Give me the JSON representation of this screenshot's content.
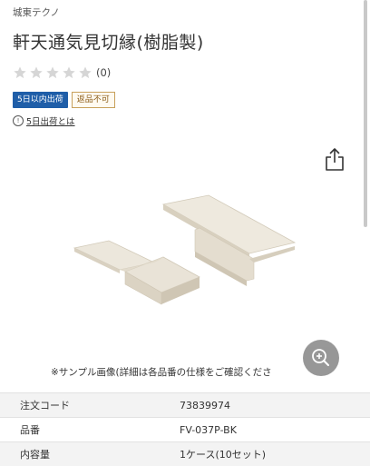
{
  "header": {
    "brand": "城東テクノ",
    "title": "軒天通気見切縁(樹脂製)"
  },
  "rating": {
    "stars_filled": 0,
    "stars_total": 5,
    "count_text": "(0)",
    "star_color": "#d6d6d6"
  },
  "badges": {
    "shipping": "5日以内出荷",
    "no_return": "返品不可"
  },
  "shipping_info": {
    "icon": "info-icon",
    "icon_glyph": "!",
    "link_text": "5日出荷とは"
  },
  "actions": {
    "share_icon": "share-icon",
    "zoom_icon": "zoom-in-icon"
  },
  "image": {
    "caption": "※サンプル画像(詳細は各品番の仕様をご確認くださ"
  },
  "specs": [
    {
      "label": "注文コード",
      "value": "73839974"
    },
    {
      "label": "品番",
      "value": "FV-037P-BK"
    },
    {
      "label": "内容量",
      "value": "1ケース(10セット)"
    }
  ],
  "colors": {
    "accent_blue": "#1f5ea8",
    "badge_border": "#c8a05a",
    "product": "#e8e2d6"
  }
}
